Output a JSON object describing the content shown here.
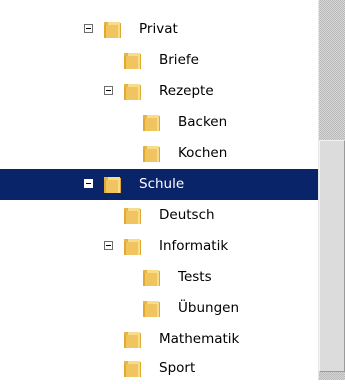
{
  "tree": {
    "items": [
      {
        "label": "Privat",
        "toggle": "minus"
      },
      {
        "label": "Briefe"
      },
      {
        "label": "Rezepte",
        "toggle": "minus"
      },
      {
        "label": "Backen"
      },
      {
        "label": "Kochen"
      },
      {
        "label": "Schule",
        "toggle": "minus",
        "selected": true
      },
      {
        "label": "Deutsch"
      },
      {
        "label": "Informatik",
        "toggle": "minus"
      },
      {
        "label": "Tests"
      },
      {
        "label": "Übungen"
      },
      {
        "label": "Mathematik"
      },
      {
        "label": "Sport"
      }
    ]
  },
  "colors": {
    "selection": "#0a246a",
    "folder": "#f0c560"
  },
  "icons": {
    "folder": "folder-icon",
    "toggle": "collapse-minus-icon"
  }
}
